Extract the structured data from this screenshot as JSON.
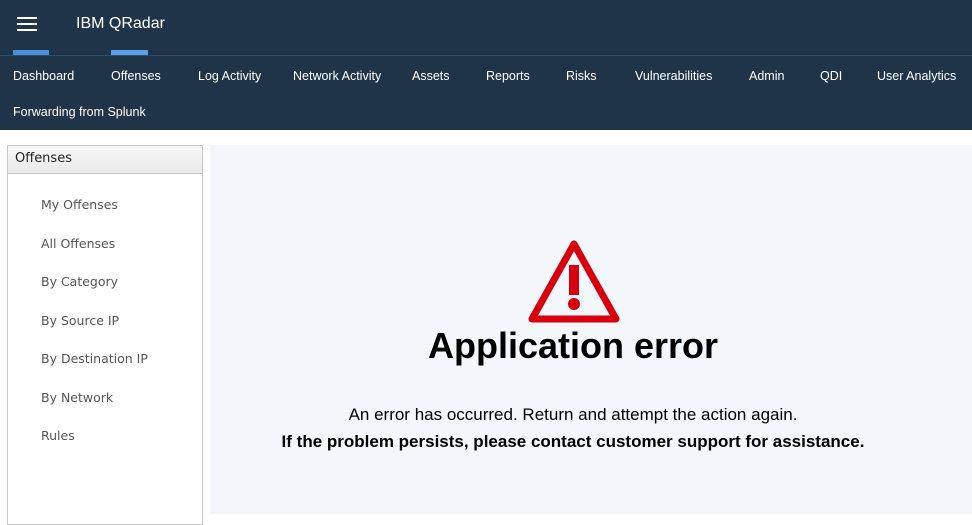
{
  "header": {
    "menu_icon": "hamburger-menu-icon",
    "title": "IBM QRadar"
  },
  "nav": {
    "tabs": [
      {
        "label": "Dashboard",
        "indicator": true
      },
      {
        "label": "Offenses",
        "indicator": true,
        "active": true
      },
      {
        "label": "Log Activity"
      },
      {
        "label": "Network Activity"
      },
      {
        "label": "Assets"
      },
      {
        "label": "Reports"
      },
      {
        "label": "Risks"
      },
      {
        "label": "Vulnerabilities"
      },
      {
        "label": "Admin"
      },
      {
        "label": "QDI"
      },
      {
        "label": "User Analytics"
      },
      {
        "label": "Forwarding from Splunk"
      }
    ],
    "indicator_color": "#4a90d9"
  },
  "sidebar": {
    "header": "Offenses",
    "items": [
      {
        "label": "My Offenses"
      },
      {
        "label": "All Offenses"
      },
      {
        "label": "By Category"
      },
      {
        "label": "By Source IP"
      },
      {
        "label": "By Destination IP"
      },
      {
        "label": "By Network"
      },
      {
        "label": "Rules"
      }
    ]
  },
  "error": {
    "icon": "warning-triangle-icon",
    "icon_color": "#d9000d",
    "title": "Application error",
    "message": "An error has occurred. Return and attempt the action again.",
    "message_bold": "If the problem persists, please contact customer support for assistance."
  }
}
